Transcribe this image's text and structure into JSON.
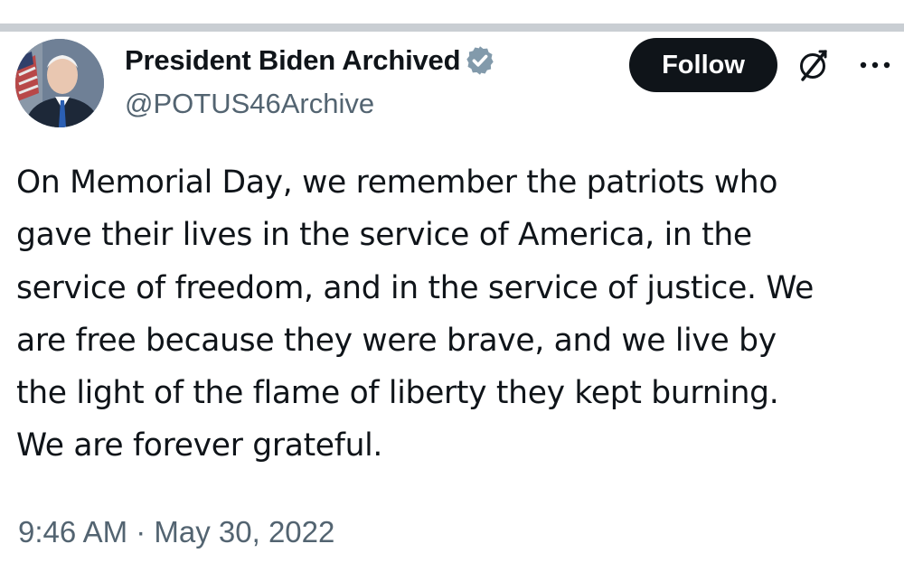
{
  "tweet": {
    "author": {
      "display_name": "President Biden Archived",
      "handle": "@POTUS46Archive",
      "verified": true
    },
    "follow_label": "Follow",
    "text_lines": [
      "On Memorial Day, we remember the patriots who",
      "gave their lives in the service of America, in the",
      "service of freedom, and in the service of justice. We",
      "are free because they were brave, and we live by",
      "the light of the flame of liberty they kept burning.",
      "We are forever grateful."
    ],
    "timestamp": "9:46 AM · May 30, 2022",
    "icons": {
      "verified": "verified-badge-icon",
      "grok": "grok-icon",
      "more": "more-options-icon"
    },
    "colors": {
      "text": "#0f1419",
      "secondary_text": "#536471",
      "follow_bg": "#0f1419",
      "verified_badge": "#829aab"
    }
  }
}
